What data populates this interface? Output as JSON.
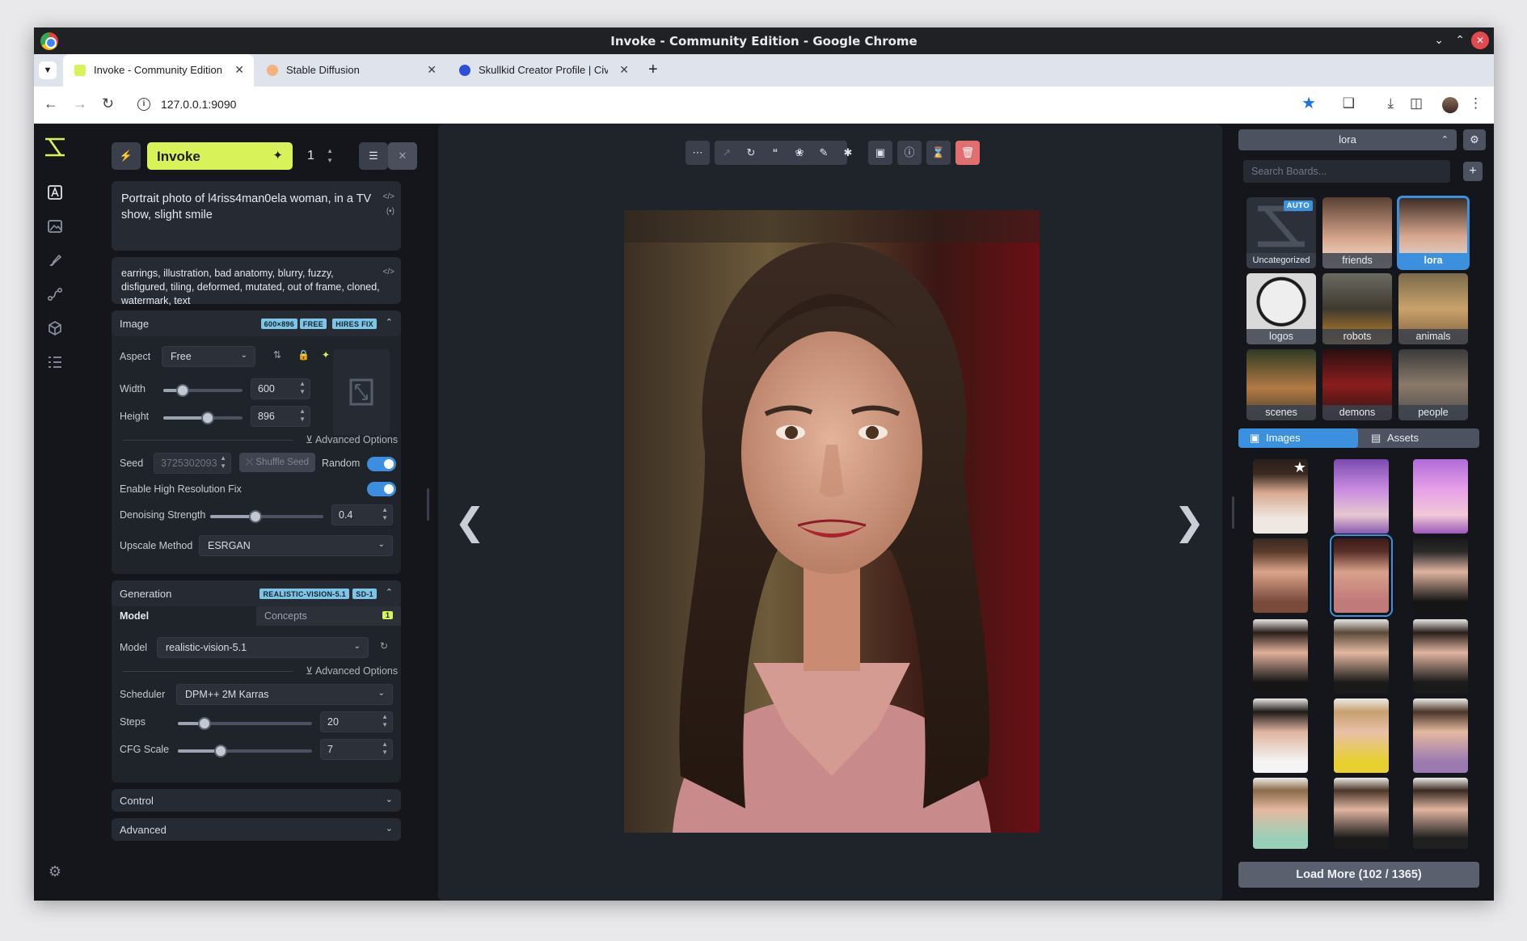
{
  "window": {
    "title": "Invoke - Community Edition - Google Chrome"
  },
  "tabs": [
    {
      "label": "Invoke - Community Edition",
      "color": "#d8f35a"
    },
    {
      "label": "Stable Diffusion",
      "color": "#f2b27a"
    },
    {
      "label": "Skullkid Creator Profile | Civit",
      "color": "#2f4fd8"
    }
  ],
  "address": {
    "url": "127.0.0.1:9090"
  },
  "invoke": {
    "label": "Invoke",
    "iterations": "1"
  },
  "prompts": {
    "positive": "Portrait photo of l4riss4man0ela woman, in a TV show, slight smile",
    "negative": "earrings, illustration, bad anatomy, blurry, fuzzy, disfigured, tiling, deformed, mutated, out of frame, cloned, watermark, text"
  },
  "image_section": {
    "title": "Image",
    "badges": [
      "600×896",
      "FREE",
      "HIRES FIX"
    ],
    "aspect_label": "Aspect",
    "aspect_value": "Free",
    "width_label": "Width",
    "width_value": "600",
    "width_fraction": 0.24,
    "height_label": "Height",
    "height_value": "896",
    "height_fraction": 0.56,
    "advanced_label": "Advanced Options",
    "seed_label": "Seed",
    "seed_value": "3725302093",
    "shuffle_label": "Shuffle Seed",
    "random_label": "Random",
    "hires_label": "Enable High Resolution Fix",
    "denoise_label": "Denoising Strength",
    "denoise_value": "0.4",
    "denoise_fraction": 0.4,
    "upscale_label": "Upscale Method",
    "upscale_value": "ESRGAN"
  },
  "generation_section": {
    "title": "Generation",
    "badges": [
      "REALISTIC-VISION-5.1",
      "SD-1"
    ],
    "tab_model": "Model",
    "tab_concepts": "Concepts",
    "concepts_count": "1",
    "model_label": "Model",
    "model_value": "realistic-vision-5.1",
    "advanced_label": "Advanced Options",
    "scheduler_label": "Scheduler",
    "scheduler_value": "DPM++ 2M Karras",
    "steps_label": "Steps",
    "steps_value": "20",
    "steps_fraction": 0.2,
    "cfg_label": "CFG Scale",
    "cfg_value": "7",
    "cfg_fraction": 0.32
  },
  "control_section": {
    "title": "Control"
  },
  "advanced_section": {
    "title": "Advanced"
  },
  "gallery": {
    "board_selected": "lora",
    "search_placeholder": "Search Boards...",
    "auto_badge": "AUTO",
    "boards": [
      "Uncategorized",
      "friends",
      "lora",
      "logos",
      "robots",
      "animals",
      "scenes",
      "demons",
      "people"
    ],
    "tab_images": "Images",
    "tab_assets": "Assets",
    "load_more": "Load More (102 / 1365)"
  },
  "colors": {
    "accent": "#3c91de",
    "invoke_button": "#d8f35a",
    "badge": "#7dc4e6",
    "delete": "#e26f6f"
  }
}
